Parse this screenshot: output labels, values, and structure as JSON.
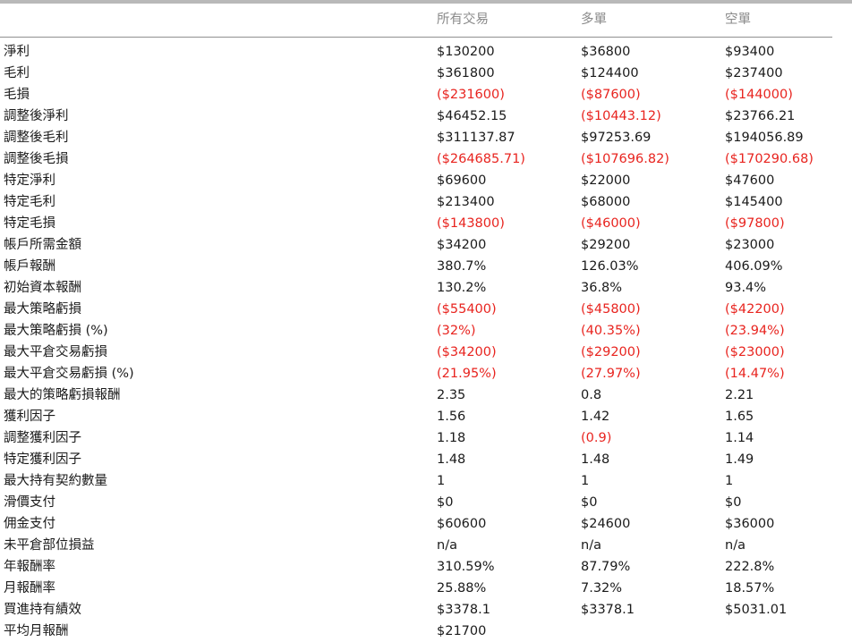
{
  "columns": {
    "all": "所有交易",
    "long": "多單",
    "short": "空單"
  },
  "colors": {
    "negative": "#e8241f",
    "text": "#1a1a1a",
    "header": "#8a8a8a"
  },
  "rows": [
    {
      "label": "淨利",
      "all": "$130200",
      "long": "$36800",
      "short": "$93400"
    },
    {
      "label": "毛利",
      "all": "$361800",
      "long": "$124400",
      "short": "$237400"
    },
    {
      "label": "毛損",
      "all": "($231600)",
      "long": "($87600)",
      "short": "($144000)"
    },
    {
      "label": "調整後淨利",
      "all": "$46452.15",
      "long": "($10443.12)",
      "short": "$23766.21"
    },
    {
      "label": "調整後毛利",
      "all": "$311137.87",
      "long": "$97253.69",
      "short": "$194056.89"
    },
    {
      "label": "調整後毛損",
      "all": "($264685.71)",
      "long": "($107696.82)",
      "short": "($170290.68)"
    },
    {
      "label": "特定淨利",
      "all": "$69600",
      "long": "$22000",
      "short": "$47600"
    },
    {
      "label": "特定毛利",
      "all": "$213400",
      "long": "$68000",
      "short": "$145400"
    },
    {
      "label": "特定毛損",
      "all": "($143800)",
      "long": "($46000)",
      "short": "($97800)"
    },
    {
      "label": "帳戶所需金額",
      "all": "$34200",
      "long": "$29200",
      "short": "$23000"
    },
    {
      "label": "帳戶報酬",
      "all": "380.7%",
      "long": "126.03%",
      "short": "406.09%"
    },
    {
      "label": "初始資本報酬",
      "all": "130.2%",
      "long": "36.8%",
      "short": "93.4%"
    },
    {
      "label": "最大策略虧損",
      "all": "($55400)",
      "long": "($45800)",
      "short": "($42200)"
    },
    {
      "label": "最大策略虧損 (%)",
      "all": "(32%)",
      "long": "(40.35%)",
      "short": "(23.94%)"
    },
    {
      "label": "最大平倉交易虧損",
      "all": "($34200)",
      "long": "($29200)",
      "short": "($23000)"
    },
    {
      "label": "最大平倉交易虧損 (%)",
      "all": "(21.95%)",
      "long": "(27.97%)",
      "short": "(14.47%)"
    },
    {
      "label": "最大的策略虧損報酬",
      "all": "2.35",
      "long": "0.8",
      "short": "2.21"
    },
    {
      "label": "獲利因子",
      "all": "1.56",
      "long": "1.42",
      "short": "1.65"
    },
    {
      "label": "調整獲利因子",
      "all": "1.18",
      "long": "(0.9)",
      "short": "1.14"
    },
    {
      "label": "特定獲利因子",
      "all": "1.48",
      "long": "1.48",
      "short": "1.49"
    },
    {
      "label": "最大持有契約數量",
      "all": "1",
      "long": "1",
      "short": "1"
    },
    {
      "label": "滑價支付",
      "all": "$0",
      "long": "$0",
      "short": "$0"
    },
    {
      "label": "佣金支付",
      "all": "$60600",
      "long": "$24600",
      "short": "$36000"
    },
    {
      "label": "未平倉部位損益",
      "all": "n/a",
      "long": "n/a",
      "short": "n/a"
    },
    {
      "label": "年報酬率",
      "all": "310.59%",
      "long": "87.79%",
      "short": "222.8%"
    },
    {
      "label": "月報酬率",
      "all": "25.88%",
      "long": "7.32%",
      "short": "18.57%"
    },
    {
      "label": "買進持有績效",
      "all": "$3378.1",
      "long": "$3378.1",
      "short": "$5031.01"
    },
    {
      "label": "平均月報酬",
      "all": "$21700",
      "long": "",
      "short": ""
    }
  ]
}
